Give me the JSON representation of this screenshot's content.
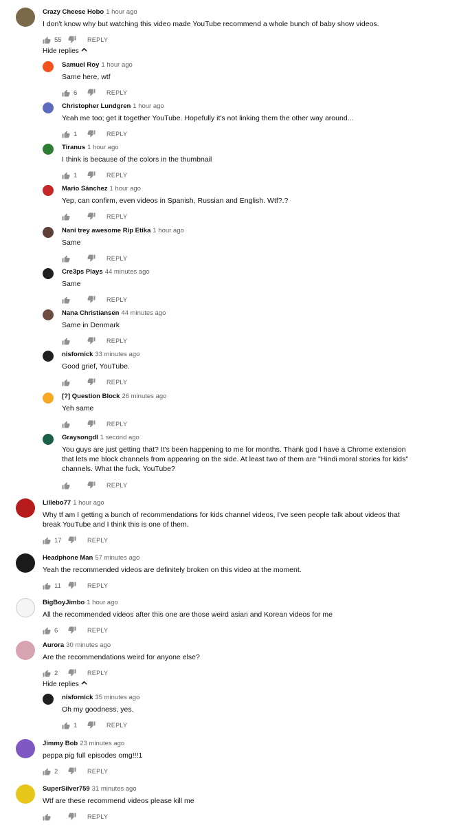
{
  "ui": {
    "reply_label": "REPLY",
    "hide_replies_label": "Hide replies"
  },
  "threads": [
    {
      "author": "Crazy Cheese Hobo",
      "time": "1 hour ago",
      "text": "I don't know why but watching this video made YouTube recommend a whole bunch of baby show videos.",
      "likes": "55",
      "avatar_color": "#7a6a4a",
      "replies": [
        {
          "author": "Samuel Roy",
          "time": "1 hour ago",
          "text": "Same here, wtf",
          "likes": "6",
          "avatar_color": "#f4511e"
        },
        {
          "author": "Christopher Lundgren",
          "time": "1 hour ago",
          "text": "Yeah me too; get it together YouTube. Hopefully it's not linking them the other way around...",
          "likes": "1",
          "avatar_color": "#5c6bc0"
        },
        {
          "author": "Tiranus",
          "time": "1 hour ago",
          "text": "I think is because of the colors in the thumbnail",
          "likes": "1",
          "avatar_color": "#2e7d32"
        },
        {
          "author": "Mario Sánchez",
          "time": "1 hour ago",
          "text": "Yep, can confirm, even videos in Spanish, Russian and English. Wtf?.?",
          "likes": "",
          "avatar_color": "#c62828"
        },
        {
          "author": "Nani trey awesome Rip Etika",
          "time": "1 hour ago",
          "text": "Same",
          "likes": "",
          "avatar_color": "#5d4037"
        },
        {
          "author": "Cre3ps Plays",
          "time": "44 minutes ago",
          "text": "Same",
          "likes": "",
          "avatar_color": "#212121"
        },
        {
          "author": "Nana Christiansen",
          "time": "44 minutes ago",
          "text": "Same in Denmark",
          "likes": "",
          "avatar_color": "#6d4c41"
        },
        {
          "author": "nisfornick",
          "time": "33 minutes ago",
          "text": "Good grief, YouTube.",
          "likes": "",
          "avatar_color": "#212121"
        },
        {
          "author": "[?] Question Block",
          "time": "26 minutes ago",
          "text": "Yeh same",
          "likes": "",
          "avatar_color": "#f9a825"
        },
        {
          "author": "Graysongdl",
          "time": "1 second ago",
          "text": "You guys are just getting that? It's been happening to me for months. Thank god I have a Chrome extension that lets me block channels from appearing on the side. At least two of them are \"Hindi moral stories for kids\" channels. What the fuck, YouTube?",
          "likes": "",
          "avatar_color": "#1b5e4a"
        }
      ]
    },
    {
      "author": "Lillebo77",
      "time": "1 hour ago",
      "text": "Why tf am I getting a bunch of recommendations for kids channel videos, I've seen people talk about videos that break YouTube and I think this is one of them.",
      "likes": "17",
      "avatar_color": "#b71c1c",
      "replies": []
    },
    {
      "author": "Headphone Man",
      "time": "57 minutes ago",
      "text": "Yeah the recommended videos are definitely broken on this video at the moment.",
      "likes": "11",
      "avatar_color": "#1a1a1a",
      "replies": []
    },
    {
      "author": "BigBoyJimbo",
      "time": "1 hour ago",
      "text": "All the recommended videos after this one are those weird asian and Korean videos for me",
      "likes": "6",
      "avatar_color": "#f5f5f5",
      "replies": []
    },
    {
      "author": "Aurora",
      "time": "30 minutes ago",
      "text": "Are the recommendations weird for anyone else?",
      "likes": "2",
      "avatar_color": "#d7a3b0",
      "replies": [
        {
          "author": "nisfornick",
          "time": "35 minutes ago",
          "text": "Oh my goodness, yes.",
          "likes": "1",
          "avatar_color": "#212121"
        }
      ]
    },
    {
      "author": "Jimmy Bob",
      "time": "23 minutes ago",
      "text": "peppa pig full episodes omg!!!1",
      "likes": "2",
      "avatar_color": "#7e57c2",
      "replies": []
    },
    {
      "author": "SuperSilver759",
      "time": "31 minutes ago",
      "text": "Wtf are these recommend videos please kill me",
      "likes": "",
      "avatar_color": "#e6c619",
      "replies": []
    }
  ]
}
